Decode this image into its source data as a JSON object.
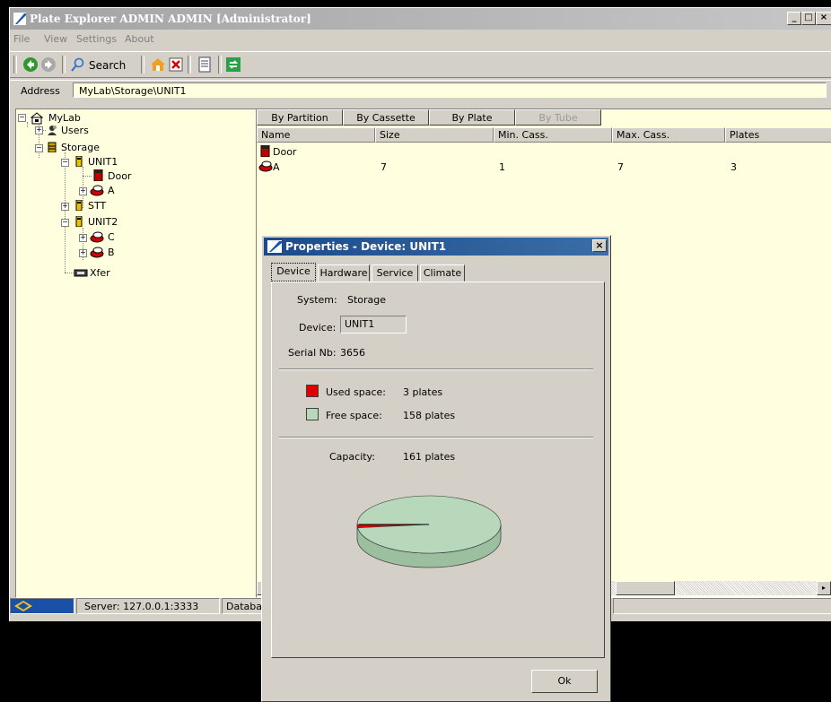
{
  "window": {
    "title": "Plate Explorer ADMIN ADMIN [Administrator]",
    "controls": [
      "_",
      "□",
      "×"
    ]
  },
  "menu": [
    "File",
    "View",
    "Settings",
    "About"
  ],
  "toolbar": {
    "search_label": "Search"
  },
  "address": {
    "label": "Address",
    "value": "MyLab\\Storage\\UNIT1"
  },
  "tree": {
    "root": "MyLab",
    "users": "Users",
    "storage": "Storage",
    "unit1": "UNIT1",
    "door": "Door",
    "a": "A",
    "stt": "STT",
    "unit2": "UNIT2",
    "c": "C",
    "b": "B",
    "xfer": "Xfer"
  },
  "list": {
    "view_tabs": [
      "By Partition",
      "By Cassette",
      "By Plate",
      "By Tube"
    ],
    "columns": [
      "Name",
      "Size",
      "Min. Cass.",
      "Max. Cass.",
      "Plates"
    ],
    "rows": [
      {
        "name": "Door",
        "size": "",
        "min": "",
        "max": "",
        "plates": ""
      },
      {
        "name": "A",
        "size": "7",
        "min": "1",
        "max": "7",
        "plates": "3"
      }
    ]
  },
  "status": {
    "server": "Server: 127.0.0.1:3333",
    "database": "Databa"
  },
  "dialog": {
    "title": "Properties - Device: UNIT1",
    "close": "×",
    "tabs": [
      "Device",
      "Hardware",
      "Service",
      "Climate"
    ],
    "system_label": "System:",
    "system_value": "Storage",
    "device_label": "Device:",
    "device_value": "UNIT1",
    "serial_label": "Serial Nb:",
    "serial_value": "3656",
    "used_label": "Used space:",
    "used_value": "3  plates",
    "free_label": "Free space:",
    "free_value": "158  plates",
    "capacity_label": "Capacity:",
    "capacity_value": "161  plates",
    "ok_label": "Ok"
  },
  "colors": {
    "used": "#e00000",
    "free": "#b8d8bc",
    "panel_bg": "#ffffe0"
  },
  "chart_data": {
    "type": "pie",
    "categories": [
      "Used space",
      "Free space"
    ],
    "values": [
      3,
      158
    ]
  }
}
